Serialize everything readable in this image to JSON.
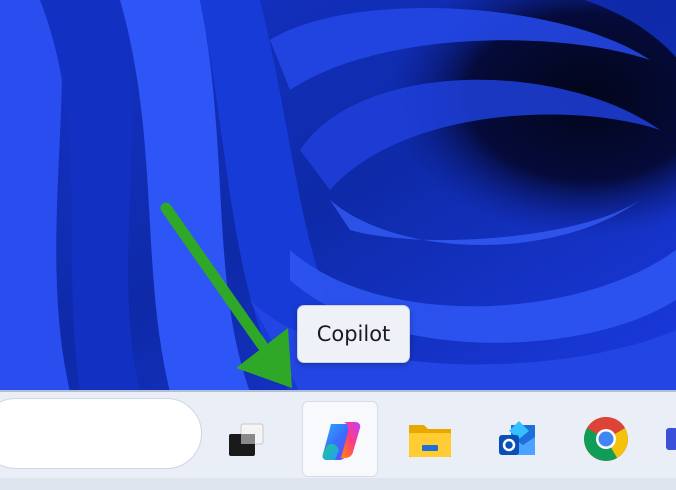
{
  "tooltip": {
    "text": "Copilot"
  },
  "taskbar": {
    "search_placeholder": "",
    "apps": [
      {
        "id": "task-view",
        "icon": "task-view-icon"
      },
      {
        "id": "copilot",
        "icon": "copilot-icon",
        "active": true
      },
      {
        "id": "file-explorer",
        "icon": "folder-icon"
      },
      {
        "id": "outlook",
        "icon": "outlook-icon"
      },
      {
        "id": "chrome",
        "icon": "chrome-icon"
      }
    ]
  },
  "colors": {
    "wallpaper_blue": "#1f3fe0",
    "arrow_green": "#2fa828",
    "taskbar_bg": "#e9eef7"
  }
}
